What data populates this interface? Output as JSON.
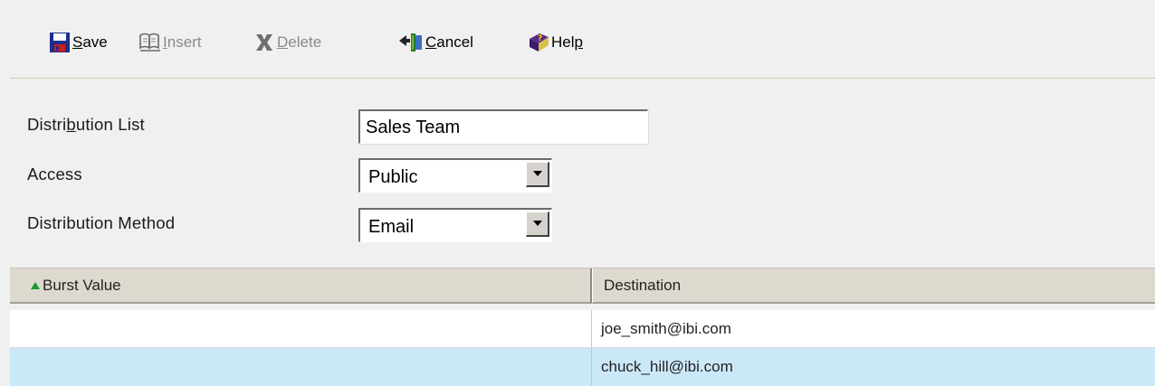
{
  "toolbar": {
    "save": {
      "prefix": "",
      "ul": "S",
      "rest": "ave",
      "icon": "floppy-disk-icon"
    },
    "insert": {
      "prefix": "",
      "ul": "I",
      "rest": "nsert",
      "icon": "insert-book-icon",
      "enabled": false
    },
    "delete": {
      "prefix": "",
      "ul": "D",
      "rest": "elete",
      "icon": "delete-x-icon",
      "enabled": false
    },
    "cancel": {
      "prefix": "",
      "ul": "C",
      "rest": "ancel",
      "icon": "cancel-undo-icon"
    },
    "help": {
      "prefix": "Hel",
      "ul": "p",
      "rest": "",
      "icon": "help-book-icon"
    }
  },
  "form": {
    "distribution_list": {
      "label_pre": "Distri",
      "label_ul": "b",
      "label_post": "ution List",
      "value": "Sales Team"
    },
    "access": {
      "label": "Access",
      "value": "Public"
    },
    "distribution_method": {
      "label": "Distribution Method",
      "value": "Email"
    }
  },
  "grid": {
    "columns": [
      {
        "label": "Burst Value",
        "sorted": "ascending"
      },
      {
        "label": "Destination"
      }
    ],
    "rows": [
      {
        "burst_value": "",
        "destination": "joe_smith@ibi.com",
        "selected": false
      },
      {
        "burst_value": "",
        "destination": "chuck_hill@ibi.com",
        "selected": true
      }
    ]
  },
  "colors": {
    "background": "#f0f0f0",
    "selected_row": "#cbe8f8",
    "header_bg": "#ded9cf",
    "sort_arrow": "#1a9a2a",
    "disabled_text": "#8a8a8a"
  }
}
